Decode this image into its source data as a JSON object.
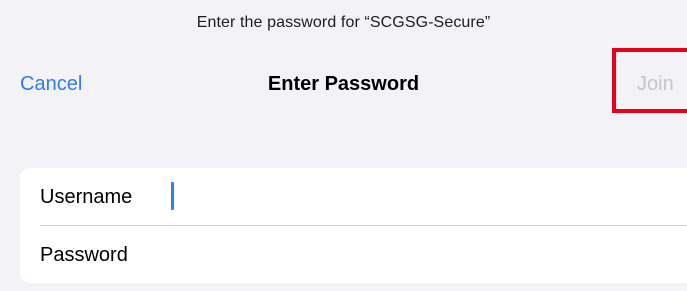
{
  "prompt": "Enter the password for “SCGSG-Secure”",
  "nav": {
    "cancel_label": "Cancel",
    "title": "Enter Password",
    "join_label": "Join"
  },
  "form": {
    "username_label": "Username",
    "username_value": "",
    "password_label": "Password",
    "password_value": ""
  },
  "colors": {
    "accent": "#2f7cf6",
    "disabled_text": "#c6c6c8",
    "highlight": "#e8001a",
    "background": "#f2f2f7"
  }
}
